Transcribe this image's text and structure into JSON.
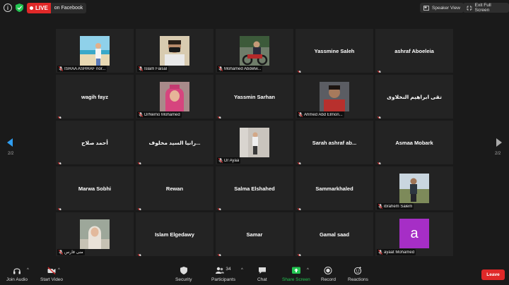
{
  "top_bar": {
    "live_tag": "LIVE",
    "live_service": "on Facebook",
    "speaker_view": "Speaker View",
    "exit_full_screen": "Exit Full Screen"
  },
  "pagination": {
    "left": "2/2",
    "right": "2/2"
  },
  "tiles": [
    {
      "label": "ISRAA ASHRAF nor...",
      "center": "",
      "photo": "beach",
      "muted": true
    },
    {
      "label": "Islam Faisal",
      "center": "",
      "photo": "man-mask",
      "muted": true
    },
    {
      "label": "Mohamed Abdelw...",
      "center": "",
      "photo": "bike",
      "muted": true
    },
    {
      "label": "",
      "center": "Yassmine Saleh",
      "photo": "",
      "muted": true
    },
    {
      "label": "",
      "center": "ashraf Aboeleia",
      "photo": "",
      "muted": true
    },
    {
      "label": "",
      "center": "wagih fayz",
      "photo": "",
      "muted": true
    },
    {
      "label": "DrNemo Mohamed",
      "center": "",
      "photo": "woman-pink",
      "muted": true
    },
    {
      "label": "",
      "center": "Yassmin Sarhan",
      "photo": "",
      "muted": true
    },
    {
      "label": "Ahmed Abd Elmon...",
      "center": "",
      "photo": "man-red",
      "muted": true
    },
    {
      "label": "",
      "center": "تقى ابراهيم النخلاوى",
      "photo": "",
      "muted": true
    },
    {
      "label": "",
      "center": "أحمد صلاح",
      "photo": "",
      "muted": true
    },
    {
      "label": "",
      "center": "رانيا السيد مخلوف...",
      "photo": "",
      "muted": true
    },
    {
      "label": "Dr Ayaa",
      "center": "",
      "photo": "street",
      "muted": true
    },
    {
      "label": "",
      "center": "Sarah ashraf ab...",
      "photo": "",
      "muted": true
    },
    {
      "label": "",
      "center": "Asmaa Mobark",
      "photo": "",
      "muted": true
    },
    {
      "label": "",
      "center": "Marwa Sobhi",
      "photo": "",
      "muted": true
    },
    {
      "label": "",
      "center": "Rewan",
      "photo": "",
      "muted": true
    },
    {
      "label": "",
      "center": "Salma Elshahed",
      "photo": "",
      "muted": true
    },
    {
      "label": "",
      "center": "Sammarkhaled",
      "photo": "",
      "muted": true
    },
    {
      "label": "ibrahem Salem",
      "center": "",
      "photo": "man-field",
      "muted": true
    },
    {
      "label": "منى فارس",
      "center": "",
      "photo": "woman-wall",
      "muted": true
    },
    {
      "label": "",
      "center": "Islam Elgedawy",
      "photo": "",
      "muted": true
    },
    {
      "label": "",
      "center": "Samar",
      "photo": "",
      "muted": true
    },
    {
      "label": "",
      "center": "Gamal saad",
      "photo": "",
      "muted": true
    },
    {
      "label": "ayaat Mohamed",
      "center": "",
      "photo": "letter",
      "letter": "a",
      "muted": true
    }
  ],
  "toolbar": {
    "join_audio": "Join Audio",
    "start_video": "Start Video",
    "security": "Security",
    "participants": "Participants",
    "participants_count": "34",
    "chat": "Chat",
    "share_screen": "Share Screen",
    "record": "Record",
    "reactions": "Reactions",
    "leave": "Leave"
  },
  "colors": {
    "live": "#e02828",
    "share_green": "#23c552",
    "nav_blue": "#2f9df0",
    "avatar_purple": "#a62ec6"
  }
}
